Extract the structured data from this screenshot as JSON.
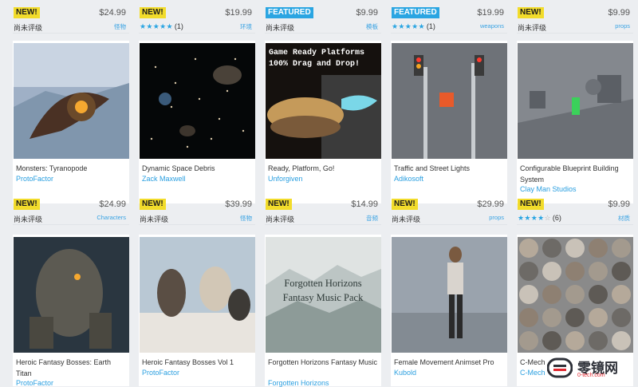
{
  "row1": [
    {
      "badge": "NEW!",
      "badge_type": "new",
      "price": "$24.99",
      "sub_left": "尚未评级",
      "sub_right": "怪物",
      "title": "Monsters: Tyranopode",
      "author": "ProtoFactor"
    },
    {
      "badge": "NEW!",
      "badge_type": "new",
      "price": "$19.99",
      "rating": 5,
      "rating_count": "(1)",
      "sub_right": "环境",
      "title": "Dynamic Space Debris",
      "author": "Zack Maxwell"
    },
    {
      "badge": "FEATURED",
      "badge_type": "featured",
      "price": "$9.99",
      "sub_left": "尚未评级",
      "sub_right": "模板",
      "title": "Ready, Platform, Go!",
      "author": "Unforgiven",
      "thumb_text": "Game Ready Platforms\n100% Drag and Drop!"
    },
    {
      "badge": "FEATURED",
      "badge_type": "featured",
      "price": "$19.99",
      "rating": 5,
      "rating_count": "(1)",
      "sub_right": "weapons",
      "title": "Traffic and Street Lights",
      "author": "Adikosoft"
    },
    {
      "badge": "NEW!",
      "badge_type": "new",
      "price": "$9.99",
      "sub_left": "尚未评级",
      "sub_right": "props",
      "title": "Configurable Blueprint Building System",
      "author": "Clay Man Studios"
    }
  ],
  "row2": [
    {
      "badge": "NEW!",
      "badge_type": "new",
      "price": "$24.99",
      "sub_left": "尚未评级",
      "sub_right": "Characters",
      "title": "Heroic Fantasy Bosses: Earth Titan",
      "author": "ProtoFactor"
    },
    {
      "badge": "NEW!",
      "badge_type": "new",
      "price": "$39.99",
      "sub_left": "尚未评级",
      "sub_right": "怪物",
      "title": "Heroic Fantasy Bosses Vol 1",
      "author": "ProtoFactor"
    },
    {
      "badge": "NEW!",
      "badge_type": "new",
      "price": "$14.99",
      "sub_left": "尚未评级",
      "sub_right": "音频",
      "title": "Forgotten Horizons Fantasy Music",
      "author": "Forgotten Horizons",
      "thumb_text": "Forgotten Horizons\nFantasy Music Pack"
    },
    {
      "badge": "NEW!",
      "badge_type": "new",
      "price": "$29.99",
      "sub_left": "尚未评级",
      "sub_right": "props",
      "title": "Female Movement Animset Pro",
      "author": "Kubold"
    },
    {
      "badge": "NEW!",
      "badge_type": "new",
      "price": "$9.99",
      "rating": 3.5,
      "rating_count": "(6)",
      "sub_right": "材质",
      "title": "C-Mech PBR Materials",
      "author": "C-Mech"
    }
  ],
  "watermark": {
    "name": "零镜网",
    "url": "0-tech.com"
  }
}
